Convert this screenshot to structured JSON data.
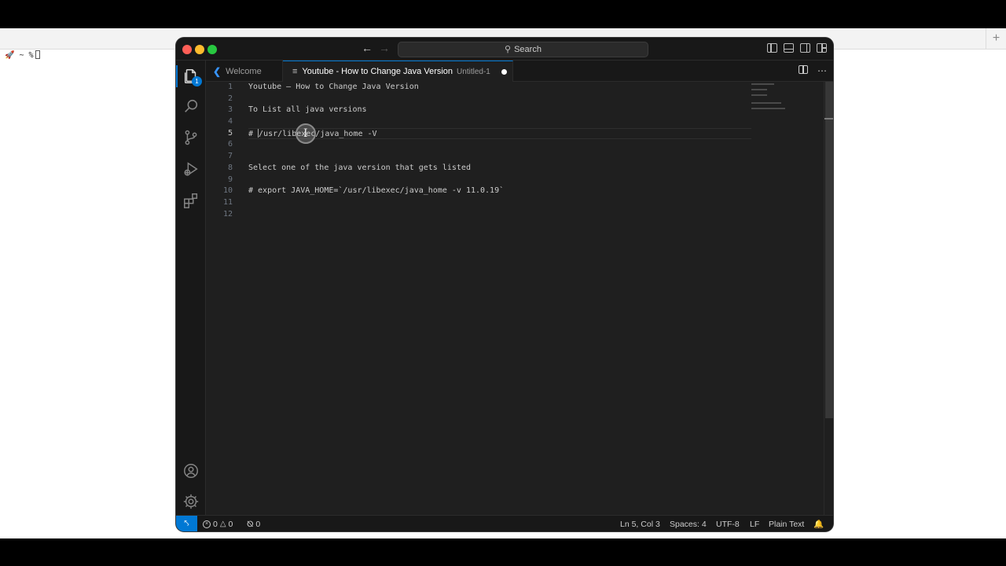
{
  "terminal": {
    "prompt": "🚀 ~ %",
    "new_tab_label": "+"
  },
  "titlebar": {
    "search_label": "Search"
  },
  "activity_bar": {
    "items": [
      {
        "name": "explorer",
        "badge": "1"
      },
      {
        "name": "search"
      },
      {
        "name": "source-control"
      },
      {
        "name": "run-and-debug"
      },
      {
        "name": "extensions"
      }
    ],
    "bottom": [
      {
        "name": "accounts"
      },
      {
        "name": "manage"
      }
    ]
  },
  "tabs": [
    {
      "label": "Welcome",
      "active": false
    },
    {
      "label": "Youtube - How to Change Java Version",
      "description": "Untitled-1",
      "active": true,
      "dirty": true
    }
  ],
  "editor": {
    "current_line": 5,
    "lines": [
      {
        "num": "1",
        "text": "Youtube — How to Change Java Version"
      },
      {
        "num": "2",
        "text": ""
      },
      {
        "num": "3",
        "text": "To List all java versions"
      },
      {
        "num": "4",
        "text": ""
      },
      {
        "num": "5",
        "text": "/usr/libexec/java_home -V",
        "prefix": "# "
      },
      {
        "num": "6",
        "text": ""
      },
      {
        "num": "7",
        "text": ""
      },
      {
        "num": "8",
        "text": "Select one of the java version that gets listed"
      },
      {
        "num": "9",
        "text": ""
      },
      {
        "num": "10",
        "text": "# export JAVA_HOME=`/usr/libexec/java_home -v 11.0.19`"
      },
      {
        "num": "11",
        "text": ""
      },
      {
        "num": "12",
        "text": ""
      }
    ]
  },
  "statusbar": {
    "errors": "0",
    "warnings": "0",
    "ports": "0",
    "cursor_position": "Ln 5, Col 3",
    "indentation": "Spaces: 4",
    "encoding": "UTF-8",
    "eol": "LF",
    "language": "Plain Text"
  },
  "colors": {
    "accent": "#0078d4",
    "editor_bg": "#1f1f1f",
    "chrome_bg": "#181818"
  }
}
